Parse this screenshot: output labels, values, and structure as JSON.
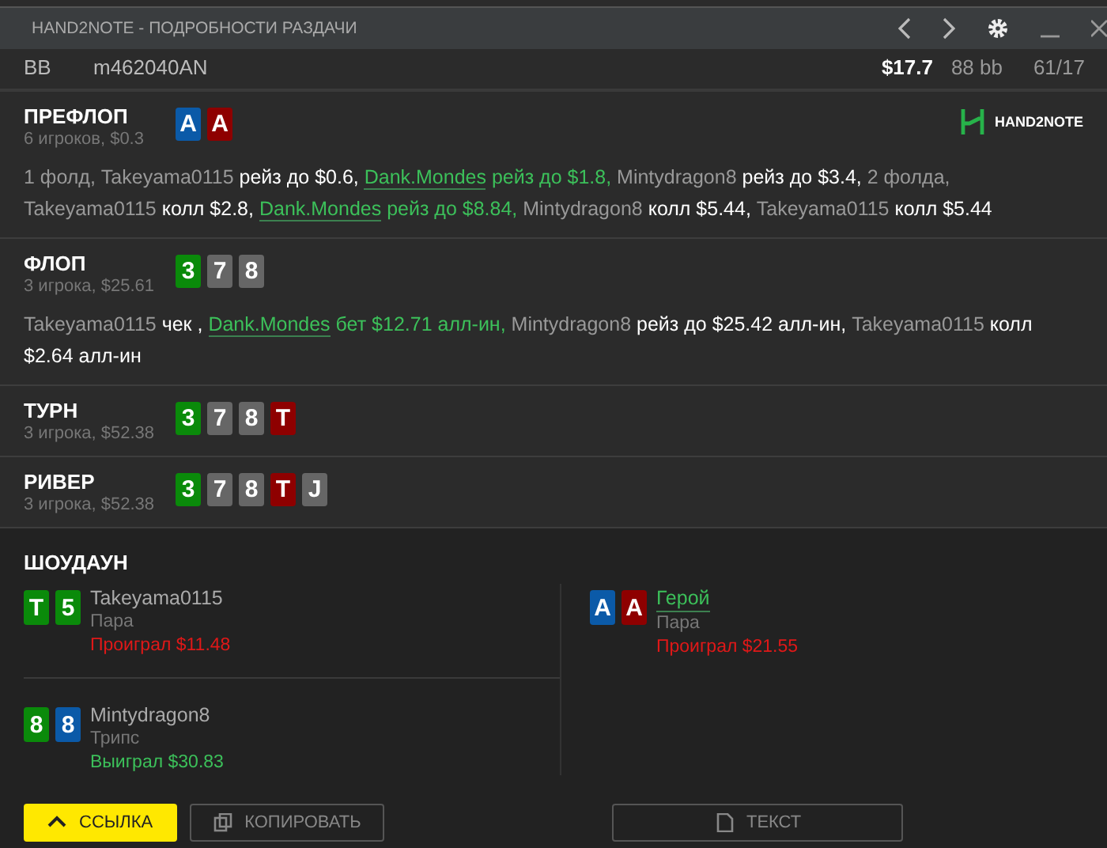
{
  "window": {
    "title": "HAND2NOTE - ПОДРОБНОСТИ РАЗДАЧИ"
  },
  "seat_rows": [
    {
      "position": "BB",
      "player": "m462040AN",
      "stack": "$17.7",
      "bb": "88 bb",
      "ratio": "61/17"
    }
  ],
  "logo": {
    "text": "HAND2NOTE"
  },
  "streets": [
    {
      "name": "ПРЕФЛОП",
      "info": "6 игроков, $0.3",
      "board": [
        {
          "rank": "A",
          "color": "#0b5aa8"
        },
        {
          "rank": "A",
          "color": "#8e0000"
        }
      ],
      "actions": [
        {
          "kind": "player",
          "text": "1 фолд, "
        },
        {
          "kind": "player",
          "text": "Takeyama0115"
        },
        {
          "kind": "action",
          "text": " рейз до $0.6, "
        },
        {
          "kind": "hero",
          "text": "Dank.Mondes"
        },
        {
          "kind": "hero_action",
          "text": " рейз до $1.8, "
        },
        {
          "kind": "player",
          "text": "Mintydragon8"
        },
        {
          "kind": "action",
          "text": " рейз до $3.4, "
        },
        {
          "kind": "player",
          "text": "2 фолда, Takeyama0115"
        },
        {
          "kind": "action",
          "text": " колл $2.8, "
        },
        {
          "kind": "hero",
          "text": "Dank.Mondes"
        },
        {
          "kind": "hero_action",
          "text": " рейз до $8.84, "
        },
        {
          "kind": "player",
          "text": "Mintydragon8"
        },
        {
          "kind": "action",
          "text": " колл $5.44, "
        },
        {
          "kind": "player",
          "text": "Takeyama0115"
        },
        {
          "kind": "action",
          "text": " колл $5.44"
        }
      ]
    },
    {
      "name": "ФЛОП",
      "info": "3 игрока, $25.61",
      "board": [
        {
          "rank": "3",
          "color": "#0a8a0a"
        },
        {
          "rank": "7",
          "color": "#666666"
        },
        {
          "rank": "8",
          "color": "#666666"
        }
      ],
      "actions": [
        {
          "kind": "player",
          "text": "Takeyama0115"
        },
        {
          "kind": "action",
          "text": " чек , "
        },
        {
          "kind": "hero",
          "text": "Dank.Mondes"
        },
        {
          "kind": "hero_action",
          "text": " бет $12.71 алл-ин, "
        },
        {
          "kind": "player",
          "text": "Mintydragon8"
        },
        {
          "kind": "action",
          "text": " рейз до $25.42 алл-ин, "
        },
        {
          "kind": "player",
          "text": "Takeyama0115"
        },
        {
          "kind": "action",
          "text": " колл $2.64 алл-ин"
        }
      ]
    },
    {
      "name": "ТУРН",
      "info": "3 игрока, $52.38",
      "board": [
        {
          "rank": "3",
          "color": "#0a8a0a"
        },
        {
          "rank": "7",
          "color": "#666666"
        },
        {
          "rank": "8",
          "color": "#666666"
        },
        {
          "rank": "T",
          "color": "#8e0000"
        }
      ]
    },
    {
      "name": "РИВЕР",
      "info": "3 игрока, $52.38",
      "board": [
        {
          "rank": "3",
          "color": "#0a8a0a"
        },
        {
          "rank": "7",
          "color": "#666666"
        },
        {
          "rank": "8",
          "color": "#666666"
        },
        {
          "rank": "T",
          "color": "#8e0000"
        },
        {
          "rank": "J",
          "color": "#666666"
        }
      ]
    }
  ],
  "showdown": {
    "title": "ШОУДАУН",
    "left": [
      {
        "cards": [
          {
            "rank": "T",
            "color": "#0a8a0a"
          },
          {
            "rank": "5",
            "color": "#0a8a0a"
          }
        ],
        "name": "Takeyama0115",
        "hero": false,
        "hand": "Пара",
        "result": "Проиграл $11.48",
        "won": false
      },
      {
        "cards": [
          {
            "rank": "8",
            "color": "#0a8a0a"
          },
          {
            "rank": "8",
            "color": "#0b5aa8"
          }
        ],
        "name": "Mintydragon8",
        "hero": false,
        "hand": "Трипс",
        "result": "Выиграл $30.83",
        "won": true
      }
    ],
    "right": [
      {
        "cards": [
          {
            "rank": "A",
            "color": "#0b5aa8"
          },
          {
            "rank": "A",
            "color": "#8e0000"
          }
        ],
        "name": "Герой",
        "hero": true,
        "hand": "Пара",
        "result": "Проиграл $21.55",
        "won": false
      }
    ]
  },
  "buttons": [
    {
      "kind": "primary",
      "label": "ССЫЛКА"
    },
    {
      "kind": "outline",
      "label": "КОПИРОВАТЬ"
    },
    {
      "kind": "outline",
      "label": "ТЕКСТ"
    }
  ]
}
